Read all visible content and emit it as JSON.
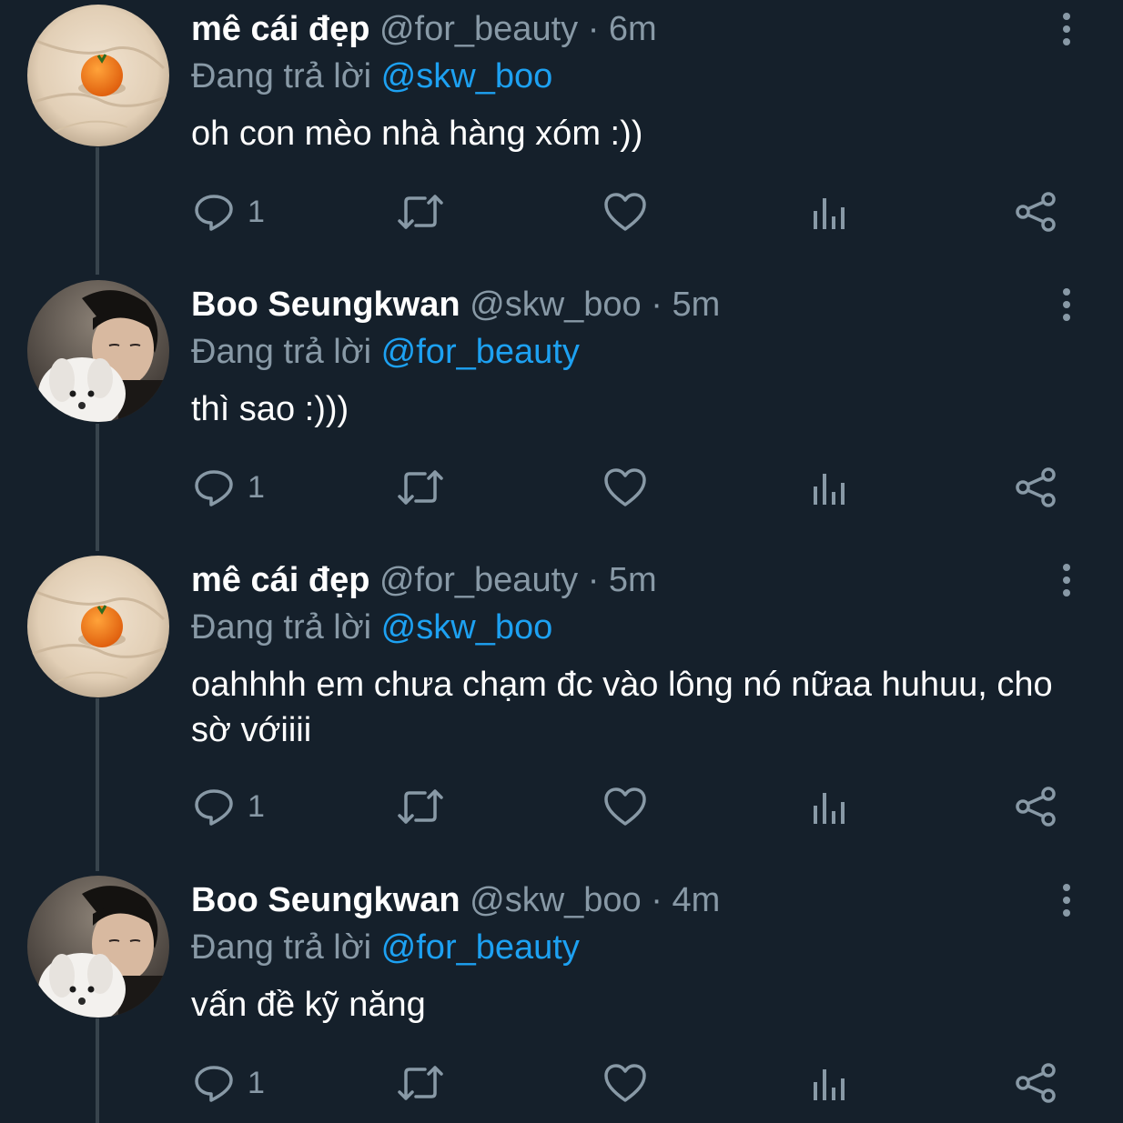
{
  "colors": {
    "background": "#15202b",
    "secondary": "#8899a6",
    "mention": "#1da1f2",
    "thread_line": "#38444d"
  },
  "tweets": [
    {
      "name": "mê cái đẹp",
      "handle": "@for_beauty",
      "time": "6m",
      "reply_prefix": "Đang trả lời",
      "reply_to": "@skw_boo",
      "text": "oh con mèo nhà hàng xóm :))",
      "reply_count": "1",
      "avatar_icon": "orange-on-blanket-avatar"
    },
    {
      "name": "Boo Seungkwan",
      "handle": "@skw_boo",
      "time": "5m",
      "reply_prefix": "Đang trả lời",
      "reply_to": "@for_beauty",
      "text": "thì sao :)))",
      "reply_count": "1",
      "avatar_icon": "person-with-dog-avatar"
    },
    {
      "name": "mê cái đẹp",
      "handle": "@for_beauty",
      "time": "5m",
      "reply_prefix": "Đang trả lời",
      "reply_to": "@skw_boo",
      "text": "oahhhh em chưa chạm đc vào lông nó nữaa huhuu, cho sờ vớiiii",
      "reply_count": "1",
      "avatar_icon": "orange-on-blanket-avatar"
    },
    {
      "name": "Boo Seungkwan",
      "handle": "@skw_boo",
      "time": "4m",
      "reply_prefix": "Đang trả lời",
      "reply_to": "@for_beauty",
      "text": "vấn đề kỹ năng",
      "reply_count": "1",
      "avatar_icon": "person-with-dog-avatar"
    }
  ]
}
